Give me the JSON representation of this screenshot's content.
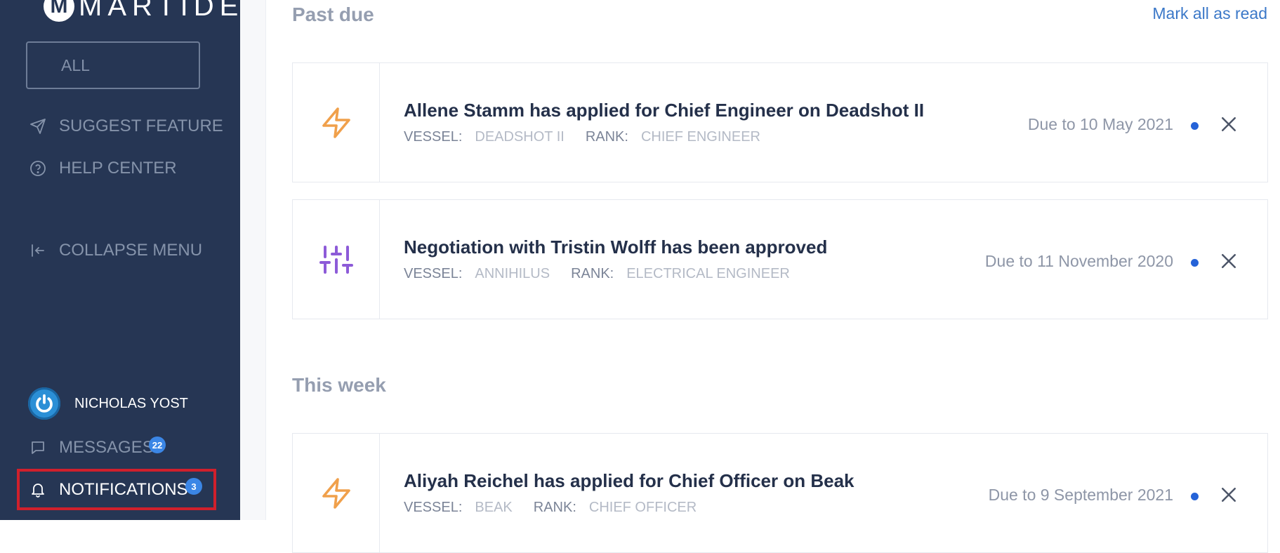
{
  "sidebar": {
    "logo_text": "MARTIDE",
    "filter_label": "ALL",
    "suggest_feature": "SUGGEST FEATURE",
    "help_center": "HELP CENTER",
    "collapse_menu": "COLLAPSE MENU",
    "user_name": "NICHOLAS YOST",
    "messages_label": "MESSAGES",
    "messages_count": "22",
    "notifications_label": "NOTIFICATIONS",
    "notifications_count": "3"
  },
  "main": {
    "mark_all_read": "Mark all as read",
    "sections": [
      {
        "title": "Past due",
        "notifications": [
          {
            "icon": "lightning-icon",
            "title": "Allene Stamm has applied for Chief Engineer on Deadshot II",
            "vessel_key": "VESSEL:",
            "vessel": "DEADSHOT II",
            "rank_key": "RANK:",
            "rank": "CHIEF ENGINEER",
            "due": "Due to 10 May 2021"
          },
          {
            "icon": "sliders-icon",
            "title": "Negotiation with Tristin Wolff has been approved",
            "vessel_key": "VESSEL:",
            "vessel": "ANNIHILUS",
            "rank_key": "RANK:",
            "rank": "ELECTRICAL ENGINEER",
            "due": "Due to 11 November 2020"
          }
        ]
      },
      {
        "title": "This week",
        "notifications": [
          {
            "icon": "lightning-icon",
            "title": "Aliyah Reichel has applied for Chief Officer on Beak",
            "vessel_key": "VESSEL:",
            "vessel": "BEAK",
            "rank_key": "RANK:",
            "rank": "CHIEF OFFICER",
            "due": "Due to 9 September 2021"
          }
        ]
      }
    ]
  },
  "colors": {
    "sidebar_bg": "#263654",
    "lightning": "#f0a04b",
    "sliders": "#8d5bd8",
    "unread_dot": "#2563d8",
    "highlight": "#d0202c"
  }
}
